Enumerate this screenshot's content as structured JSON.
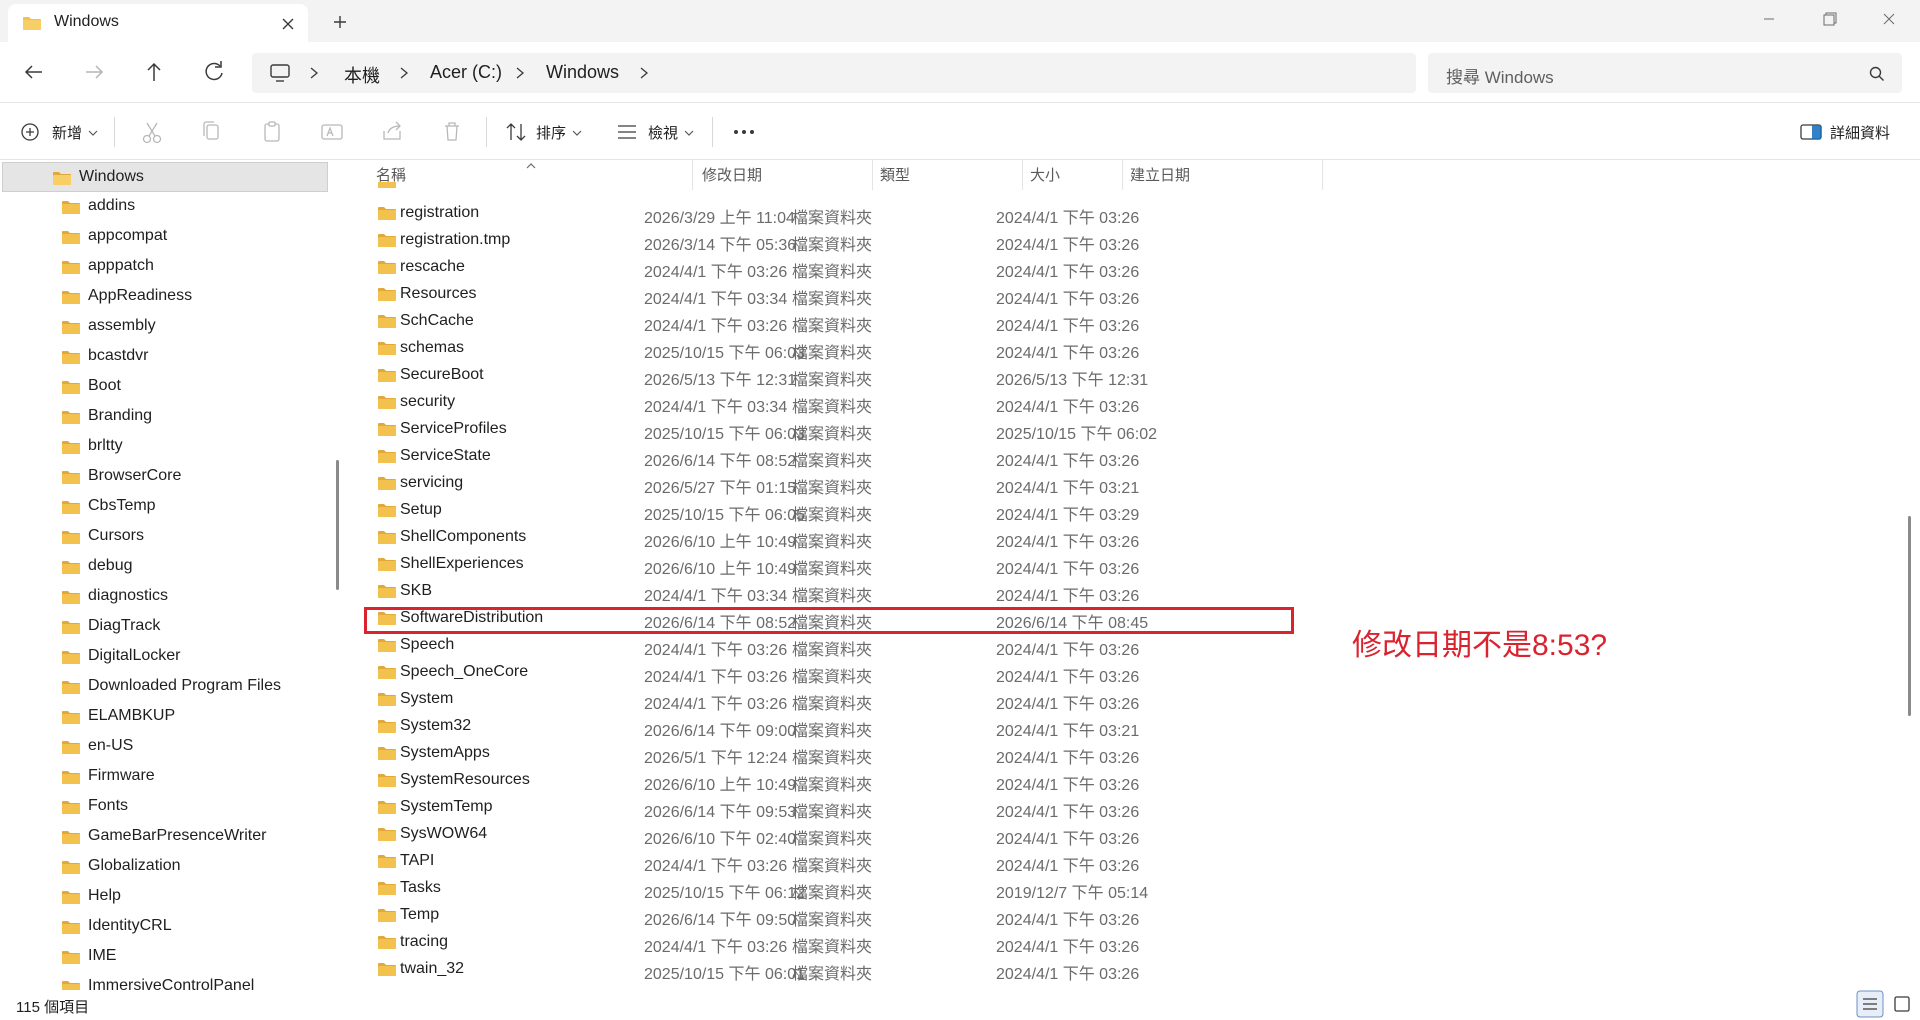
{
  "window": {
    "tab_title": "Windows",
    "controls": [
      "minimize",
      "maximize",
      "close"
    ]
  },
  "address": {
    "crumbs": [
      "本機",
      "Acer (C:)",
      "Windows"
    ],
    "search_placeholder": "搜尋 Windows"
  },
  "toolbar": {
    "new_label": "新增",
    "sort_label": "排序",
    "view_label": "檢視",
    "details_label": "詳細資料"
  },
  "nav": {
    "selected": "Windows",
    "items": [
      "addins",
      "appcompat",
      "apppatch",
      "AppReadiness",
      "assembly",
      "bcastdvr",
      "Boot",
      "Branding",
      "brltty",
      "BrowserCore",
      "CbsTemp",
      "Cursors",
      "debug",
      "diagnostics",
      "DiagTrack",
      "DigitalLocker",
      "Downloaded Program Files",
      "ELAMBKUP",
      "en-US",
      "Firmware",
      "Fonts",
      "GameBarPresenceWriter",
      "Globalization",
      "Help",
      "IdentityCRL",
      "IME",
      "ImmersiveControlPanel"
    ]
  },
  "columns": {
    "name": "名稱",
    "modified": "修改日期",
    "type": "類型",
    "size": "大小",
    "created": "建立日期"
  },
  "files": [
    {
      "name": "registration",
      "modified": "2026/3/29 上午 11:04",
      "type": "檔案資料夾",
      "created": "2024/4/1 下午 03:26"
    },
    {
      "name": "registration.tmp",
      "modified": "2026/3/14 下午 05:36",
      "type": "檔案資料夾",
      "created": "2024/4/1 下午 03:26"
    },
    {
      "name": "rescache",
      "modified": "2024/4/1 下午 03:26",
      "type": "檔案資料夾",
      "created": "2024/4/1 下午 03:26"
    },
    {
      "name": "Resources",
      "modified": "2024/4/1 下午 03:34",
      "type": "檔案資料夾",
      "created": "2024/4/1 下午 03:26"
    },
    {
      "name": "SchCache",
      "modified": "2024/4/1 下午 03:26",
      "type": "檔案資料夾",
      "created": "2024/4/1 下午 03:26"
    },
    {
      "name": "schemas",
      "modified": "2025/10/15 下午 06:03",
      "type": "檔案資料夾",
      "created": "2024/4/1 下午 03:26"
    },
    {
      "name": "SecureBoot",
      "modified": "2026/5/13 下午 12:31",
      "type": "檔案資料夾",
      "created": "2026/5/13 下午 12:31"
    },
    {
      "name": "security",
      "modified": "2024/4/1 下午 03:34",
      "type": "檔案資料夾",
      "created": "2024/4/1 下午 03:26"
    },
    {
      "name": "ServiceProfiles",
      "modified": "2025/10/15 下午 06:03",
      "type": "檔案資料夾",
      "created": "2025/10/15 下午 06:02"
    },
    {
      "name": "ServiceState",
      "modified": "2026/6/14 下午 08:52",
      "type": "檔案資料夾",
      "created": "2024/4/1 下午 03:26"
    },
    {
      "name": "servicing",
      "modified": "2026/5/27 下午 01:15",
      "type": "檔案資料夾",
      "created": "2024/4/1 下午 03:21"
    },
    {
      "name": "Setup",
      "modified": "2025/10/15 下午 06:05",
      "type": "檔案資料夾",
      "created": "2024/4/1 下午 03:29"
    },
    {
      "name": "ShellComponents",
      "modified": "2026/6/10 上午 10:49",
      "type": "檔案資料夾",
      "created": "2024/4/1 下午 03:26"
    },
    {
      "name": "ShellExperiences",
      "modified": "2026/6/10 上午 10:49",
      "type": "檔案資料夾",
      "created": "2024/4/1 下午 03:26"
    },
    {
      "name": "SKB",
      "modified": "2024/4/1 下午 03:34",
      "type": "檔案資料夾",
      "created": "2024/4/1 下午 03:26"
    },
    {
      "name": "SoftwareDistribution",
      "modified": "2026/6/14 下午 08:52",
      "type": "檔案資料夾",
      "created": "2026/6/14 下午 08:45"
    },
    {
      "name": "Speech",
      "modified": "2024/4/1 下午 03:26",
      "type": "檔案資料夾",
      "created": "2024/4/1 下午 03:26"
    },
    {
      "name": "Speech_OneCore",
      "modified": "2024/4/1 下午 03:26",
      "type": "檔案資料夾",
      "created": "2024/4/1 下午 03:26"
    },
    {
      "name": "System",
      "modified": "2024/4/1 下午 03:26",
      "type": "檔案資料夾",
      "created": "2024/4/1 下午 03:26"
    },
    {
      "name": "System32",
      "modified": "2026/6/14 下午 09:00",
      "type": "檔案資料夾",
      "created": "2024/4/1 下午 03:21"
    },
    {
      "name": "SystemApps",
      "modified": "2026/5/1 下午 12:24",
      "type": "檔案資料夾",
      "created": "2024/4/1 下午 03:26"
    },
    {
      "name": "SystemResources",
      "modified": "2026/6/10 上午 10:49",
      "type": "檔案資料夾",
      "created": "2024/4/1 下午 03:26"
    },
    {
      "name": "SystemTemp",
      "modified": "2026/6/14 下午 09:53",
      "type": "檔案資料夾",
      "created": "2024/4/1 下午 03:26"
    },
    {
      "name": "SysWOW64",
      "modified": "2026/6/10 下午 02:40",
      "type": "檔案資料夾",
      "created": "2024/4/1 下午 03:26"
    },
    {
      "name": "TAPI",
      "modified": "2024/4/1 下午 03:26",
      "type": "檔案資料夾",
      "created": "2024/4/1 下午 03:26"
    },
    {
      "name": "Tasks",
      "modified": "2025/10/15 下午 06:12",
      "type": "檔案資料夾",
      "created": "2019/12/7 下午 05:14"
    },
    {
      "name": "Temp",
      "modified": "2026/6/14 下午 09:50",
      "type": "檔案資料夾",
      "created": "2024/4/1 下午 03:26"
    },
    {
      "name": "tracing",
      "modified": "2024/4/1 下午 03:26",
      "type": "檔案資料夾",
      "created": "2024/4/1 下午 03:26"
    },
    {
      "name": "twain_32",
      "modified": "2025/10/15 下午 06:01",
      "type": "檔案資料夾",
      "created": "2024/4/1 下午 03:26"
    }
  ],
  "highlighted_file": "SoftwareDistribution",
  "annotation": "修改日期不是8:53?",
  "status": {
    "item_count": "115 個項目"
  },
  "colors": {
    "folder": "#f2c14e",
    "folder_dark": "#e0a93a",
    "highlight": "#d9232e",
    "selection": "#e5e5e5"
  }
}
